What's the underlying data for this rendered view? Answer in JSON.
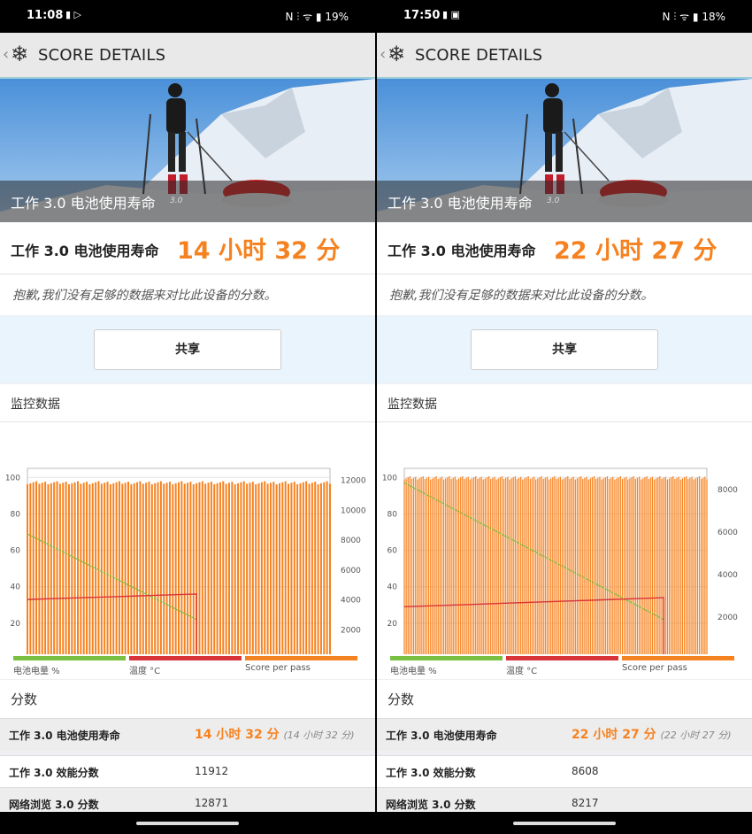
{
  "panels": [
    {
      "status": {
        "time": "11:08",
        "icons_left": "▮ ▷",
        "right": "N ⫶ ᯤ ▮ 19%"
      },
      "title_bar": {
        "title": "SCORE DETAILS",
        "back_icon": "chevron-left",
        "logo_icon": "snowflake"
      },
      "hero": {
        "caption": "工作 3.0 电池使用寿命",
        "caption_small": "3.0"
      },
      "result": {
        "label": "工作 3.0 电池使用寿命",
        "value": "14 小时 32 分"
      },
      "note": "抱歉,我们没有足够的数据来对比此设备的分数。",
      "share_label": "共享",
      "monitor_title": "监控数据",
      "chart_data": {
        "type": "bar",
        "left_axis": {
          "ticks": [
            "100",
            "80",
            "60",
            "40",
            "20"
          ],
          "range": [
            0,
            105
          ]
        },
        "right_axis": {
          "ticks": [
            "12000",
            "10000",
            "8000",
            "6000",
            "4000",
            "2000"
          ],
          "range": [
            0,
            12800
          ]
        },
        "x_ticks": [
          "Pass 0",
          "Pass 20",
          "Pass 40",
          "Pass 60",
          "Pass 80",
          "Pass 100"
        ],
        "x_tick_passes": [
          0,
          20,
          40,
          60,
          80,
          100
        ],
        "total_passes": 103,
        "active_passes": 58,
        "score_per_pass": 11912,
        "battery_start": 69,
        "battery_end": 22,
        "temperature_start": 33,
        "temperature_end": 36,
        "series": [
          {
            "name": "电池电量 %",
            "color": "#7ac143"
          },
          {
            "name": "温度 °C",
            "color": "#d9343a"
          },
          {
            "name": "Score per pass",
            "color": "#f58220"
          }
        ]
      },
      "scores_title": "分数",
      "scores": [
        {
          "key": "工作 3.0 电池使用寿命",
          "value": "14 小时 32 分",
          "sub": "(14 小时 32 分)"
        },
        {
          "key": "工作 3.0 效能分数",
          "value": "11912"
        },
        {
          "key": "网络浏览 3.0 分数",
          "value": "12871"
        }
      ]
    },
    {
      "status": {
        "time": "17:50",
        "icons_left": "▮ ▣",
        "right": "N ⫶ ᯤ ▮ 18%"
      },
      "title_bar": {
        "title": "SCORE DETAILS",
        "back_icon": "chevron-left",
        "logo_icon": "snowflake"
      },
      "hero": {
        "caption": "工作 3.0 电池使用寿命",
        "caption_small": "3.0"
      },
      "result": {
        "label": "工作 3.0 电池使用寿命",
        "value": "22 小时 27 分"
      },
      "note": "抱歉,我们没有足够的数据来对比此设备的分数。",
      "share_label": "共享",
      "monitor_title": "监控数据",
      "chart_data": {
        "type": "bar",
        "left_axis": {
          "ticks": [
            "100",
            "80",
            "60",
            "40",
            "20"
          ],
          "range": [
            0,
            105
          ]
        },
        "right_axis": {
          "ticks": [
            "8000",
            "6000",
            "4000",
            "2000"
          ],
          "range": [
            0,
            9000
          ]
        },
        "x_ticks": [
          "Pass 0",
          "Pass 40",
          "Pass 80",
          "Pass 120",
          "Pass 160"
        ],
        "x_tick_passes": [
          0,
          40,
          80,
          120,
          160
        ],
        "total_passes": 162,
        "active_passes": 139,
        "score_per_pass": 8608,
        "battery_start": 97,
        "battery_end": 22,
        "temperature_start": 29,
        "temperature_end": 34,
        "series": [
          {
            "name": "电池电量 %",
            "color": "#7ac143"
          },
          {
            "name": "温度 °C",
            "color": "#d9343a"
          },
          {
            "name": "Score per pass",
            "color": "#f58220"
          }
        ]
      },
      "scores_title": "分数",
      "scores": [
        {
          "key": "工作 3.0 电池使用寿命",
          "value": "22 小时 27 分",
          "sub": "(22 小时 27 分)"
        },
        {
          "key": "工作 3.0 效能分数",
          "value": "8608"
        },
        {
          "key": "网络浏览 3.0 分数",
          "value": "8217"
        }
      ]
    }
  ]
}
